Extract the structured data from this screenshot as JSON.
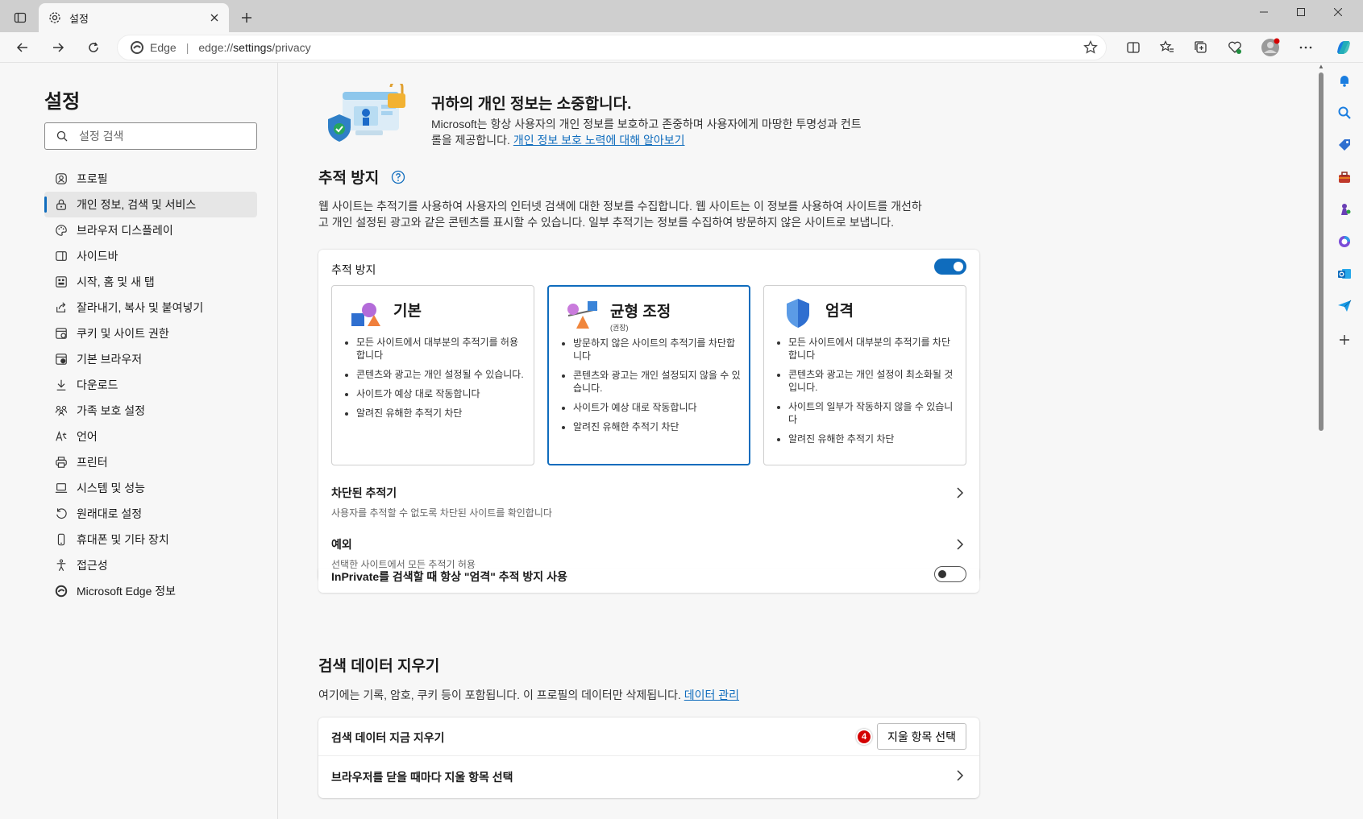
{
  "browser": {
    "tab_title": "설정",
    "address_brand": "Edge",
    "url_prefix": "edge://",
    "url_host": "settings",
    "url_path": "/privacy"
  },
  "leftnav": {
    "title": "설정",
    "search_placeholder": "설정 검색",
    "items": [
      {
        "label": "프로필",
        "icon": "profile-icon"
      },
      {
        "label": "개인 정보, 검색 및 서비스",
        "icon": "lock-icon",
        "active": true
      },
      {
        "label": "브라우저 디스플레이",
        "icon": "palette-icon"
      },
      {
        "label": "사이드바",
        "icon": "sidebar-icon"
      },
      {
        "label": "시작, 홈 및 새 탭",
        "icon": "home-grid-icon"
      },
      {
        "label": "잘라내기, 복사 및 붙여넣기",
        "icon": "share-icon"
      },
      {
        "label": "쿠키 및 사이트 권한",
        "icon": "cookie-site-icon"
      },
      {
        "label": "기본 브라우저",
        "icon": "default-browser-icon"
      },
      {
        "label": "다운로드",
        "icon": "download-icon"
      },
      {
        "label": "가족 보호 설정",
        "icon": "family-icon"
      },
      {
        "label": "언어",
        "icon": "language-icon"
      },
      {
        "label": "프린터",
        "icon": "printer-icon"
      },
      {
        "label": "시스템 및 성능",
        "icon": "laptop-icon"
      },
      {
        "label": "원래대로 설정",
        "icon": "reset-icon"
      },
      {
        "label": "휴대폰 및 기타 장치",
        "icon": "phone-icon"
      },
      {
        "label": "접근성",
        "icon": "accessibility-icon"
      },
      {
        "label": "Microsoft Edge 정보",
        "icon": "edge-logo-icon"
      }
    ]
  },
  "hero": {
    "title": "귀하의 개인 정보는 소중합니다.",
    "desc": "Microsoft는 항상 사용자의 개인 정보를 보호하고 존중하며 사용자에게 마땅한 투명성과 컨트롤을 제공합니다. ",
    "link": "개인 정보 보호 노력에 대해 알아보기"
  },
  "tracking": {
    "section_title": "추적 방지",
    "desc": "웹 사이트는 추적기를 사용하여 사용자의 인터넷 검색에 대한 정보를 수집합니다. 웹 사이트는 이 정보를 사용하여 사이트를 개선하고 개인 설정된 광고와 같은 콘텐츠를 표시할 수 있습니다. 일부 추적기는 정보를 수집하여 방문하지 않은 사이트로 보냅니다.",
    "toggle_label": "추적 방지",
    "toggle_on": true,
    "options": [
      {
        "title": "기본",
        "subtitle": "",
        "bullets": [
          "모든 사이트에서 대부분의 추적기를 허용합니다",
          "콘텐츠와 광고는 개인 설정될 수 있습니다.",
          "사이트가 예상 대로 작동합니다",
          "알려진 유해한 추적기 차단"
        ]
      },
      {
        "title": "균형 조정",
        "subtitle": "(권장)",
        "bullets": [
          "방문하지 않은 사이트의 추적기를 차단합니다",
          "콘텐츠와 광고는 개인 설정되지 않을 수 있습니다.",
          "사이트가 예상 대로 작동합니다",
          "알려진 유해한 추적기 차단"
        ],
        "selected": true
      },
      {
        "title": "엄격",
        "subtitle": "",
        "bullets": [
          "모든 사이트에서 대부분의 추적기를 차단합니다",
          "콘텐츠와 광고는 개인 설정이 최소화될 것입니다.",
          "사이트의 일부가 작동하지 않을 수 있습니다",
          "알려진 유해한 추적기 차단"
        ]
      }
    ],
    "blocked_title": "차단된 추적기",
    "blocked_sub": "사용자를 추적할 수 없도록 차단된 사이트를 확인합니다",
    "exceptions_title": "예외",
    "exceptions_sub": "선택한 사이트에서 모든 추적기 허용",
    "inprivate_label": "InPrivate를 검색할 때 항상 \"엄격\" 추적 방지 사용",
    "inprivate_on": false
  },
  "clear": {
    "section_title": "검색 데이터 지우기",
    "desc": "여기에는 기록, 암호, 쿠키 등이 포함됩니다. 이 프로필의 데이터만 삭제됩니다. ",
    "link": "데이터 관리",
    "now_label": "검색 데이터 지금 지우기",
    "choose_button": "지울 항목 선택",
    "step_badge": "4",
    "on_close_label": "브라우저를 닫을 때마다 지울 항목 선택"
  },
  "colors": {
    "accent": "#0f6cbd",
    "badge": "#d40000"
  }
}
